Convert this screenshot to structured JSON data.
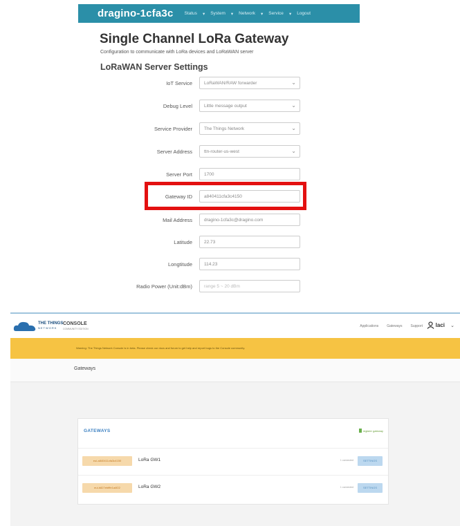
{
  "dragino": {
    "brand": "dragino-1cfa3c",
    "nav": [
      "Status",
      "System",
      "Network",
      "Service",
      "Logout"
    ],
    "title": "Single Channel LoRa Gateway",
    "subtitle": "Configuration to communicate with LoRa devices and LoRaWAN server",
    "section_title": "LoRaWAN Server Settings",
    "fields": [
      {
        "label": "IoT Service",
        "value": "LoRaWAN/RAW forwarder",
        "type": "select"
      },
      {
        "label": "Debug Level",
        "value": "Little message output",
        "type": "select"
      },
      {
        "label": "Service Provider",
        "value": "The Things Network",
        "type": "select"
      },
      {
        "label": "Server Address",
        "value": "ttn-router-us-west",
        "type": "select"
      },
      {
        "label": "Server Port",
        "value": "1700",
        "type": "input"
      },
      {
        "label": "Gateway ID",
        "value": "a840411cfa3c4150",
        "type": "input"
      },
      {
        "label": "Mail Address",
        "value": "dragino-1cfa3c@dragino.com",
        "type": "input"
      },
      {
        "label": "Latitude",
        "value": "22.73",
        "type": "input"
      },
      {
        "label": "Longtitude",
        "value": "114.23",
        "type": "input"
      },
      {
        "label": "Radio Power (Unit:dBm)",
        "value": "",
        "placeholder": "range 5 ~ 20 dBm",
        "type": "input"
      }
    ]
  },
  "ttn": {
    "logo_line1": "THE THINGS",
    "logo_line2": "NETWORK",
    "console": "CONSOLE",
    "console_sub": "COMMUNITY EDITION",
    "nav": [
      "Applications",
      "Gateways",
      "Support"
    ],
    "user": "laci",
    "warning": "Warning: The Things Network Console is in beta. Please check our docs and forum to get help and report bugs to the Console community.",
    "breadcrumb": "Gateways",
    "gateways_title": "GATEWAYS",
    "register_link": "register gateway",
    "gateways": [
      {
        "eui": "eui-a840411cfa3c4150",
        "name": "LoRa GW1",
        "status": "1 connected",
        "action": "SETTINGS"
      },
      {
        "eui": "eui-b827ebfffe1a4f22",
        "name": "LoRa GW2",
        "status": "1 connected",
        "action": "SETTINGS"
      }
    ]
  },
  "colors": {
    "navbar": "#2b8fa8",
    "highlight": "#e31010",
    "warning": "#f6c343",
    "eui_badge": "#f6d9ab"
  }
}
